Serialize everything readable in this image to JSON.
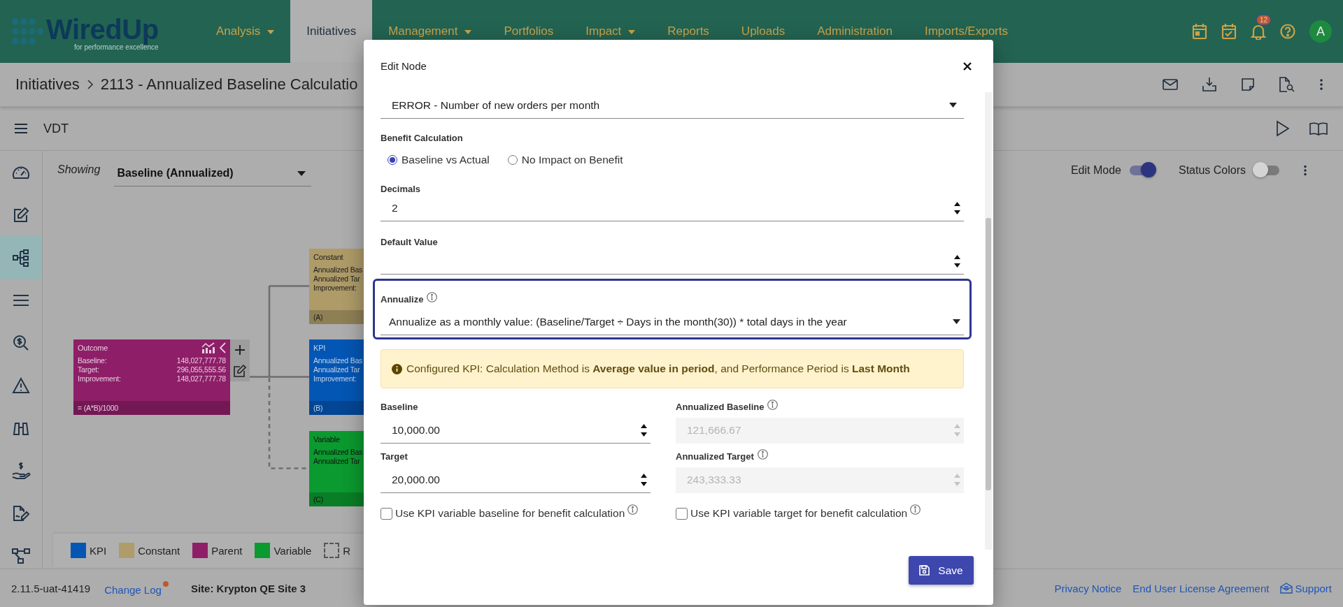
{
  "header": {
    "logo": {
      "name": "WiredUp",
      "tagline": "for performance excellence"
    },
    "nav": [
      {
        "label": "Analysis",
        "dropdown": true,
        "selected": false
      },
      {
        "label": "Initiatives",
        "dropdown": false,
        "selected": true
      },
      {
        "label": "Management",
        "dropdown": true,
        "selected": false
      },
      {
        "label": "Portfolios",
        "dropdown": false,
        "selected": false
      },
      {
        "label": "Impact",
        "dropdown": true,
        "selected": false
      },
      {
        "label": "Reports",
        "dropdown": false,
        "selected": false
      },
      {
        "label": "Uploads",
        "dropdown": false,
        "selected": false
      },
      {
        "label": "Administration",
        "dropdown": false,
        "selected": false
      },
      {
        "label": "Imports/Exports",
        "dropdown": false,
        "selected": false
      }
    ],
    "notification_count": "12",
    "avatar": "A"
  },
  "breadcrumb": [
    "Initiatives",
    "2113 - Annualized Baseline Calculatio"
  ],
  "toolbar": {
    "title": "VDT"
  },
  "sidebar": {
    "items": [
      {
        "kind": "gauge",
        "selected": false
      },
      {
        "kind": "edit",
        "selected": false
      },
      {
        "kind": "hierarchy",
        "selected": true
      },
      {
        "kind": "list",
        "selected": false
      },
      {
        "kind": "search",
        "selected": false
      },
      {
        "kind": "warning",
        "selected": false
      },
      {
        "kind": "binoculars",
        "selected": false
      },
      {
        "kind": "hand",
        "selected": false
      },
      {
        "kind": "document",
        "selected": false
      },
      {
        "kind": "network",
        "selected": false
      }
    ]
  },
  "view": {
    "showing_label": "Showing",
    "showing_value": "Baseline (Annualized)",
    "edit_mode": {
      "label": "Edit Mode",
      "on": true
    },
    "status_colors": {
      "label": "Status Colors",
      "on": false
    }
  },
  "nodes": [
    {
      "kind": "outcome",
      "title": "Outcome",
      "color": "#8e1e68",
      "rows": [
        {
          "label": "Baseline:",
          "value": "148,027,777.78"
        },
        {
          "label": "Target:",
          "value": "296,055,555.56"
        },
        {
          "label": "Improvement:",
          "value": "148,027,777.78"
        }
      ],
      "footer": "= (A*B)/1000"
    },
    {
      "kind": "constant",
      "title": "Constant",
      "color": "#ae9b68",
      "rows": [
        {
          "label": "Annualized Bas"
        },
        {
          "label": "Annualized Tar"
        },
        {
          "label": "Improvement:"
        }
      ],
      "footer": "(A)"
    },
    {
      "kind": "kpi",
      "title": "KPI",
      "color": "#0456b4",
      "rows": [
        {
          "label": "Annualized Bas"
        },
        {
          "label": "Annualized Tar"
        },
        {
          "label": "Improvement:"
        }
      ],
      "footer": "(B)"
    },
    {
      "kind": "variable",
      "title": "Variable",
      "color": "#0b9a2f",
      "rows": [
        {
          "label": "Annualized Bas"
        },
        {
          "label": "Annualized Tar"
        }
      ],
      "footer": "(C)"
    }
  ],
  "legend": [
    {
      "kind": "swatch",
      "label": "KPI",
      "color": "#0456b4"
    },
    {
      "kind": "swatch",
      "label": "Constant",
      "color": "#b09c6a"
    },
    {
      "kind": "swatch",
      "label": "Parent",
      "color": "#8e1e68"
    },
    {
      "kind": "swatch",
      "label": "Variable",
      "color": "#0b9a2f"
    },
    {
      "kind": "dashed",
      "label": "R"
    }
  ],
  "footer": {
    "version": "2.11.5-uat-41419",
    "change_log": "Change Log",
    "site": "Site: Krypton QE Site 3",
    "links": [
      {
        "label": "Privacy Notice",
        "kind": "link"
      },
      {
        "label": "End User License Agreement",
        "kind": "link"
      },
      {
        "label": "Support",
        "kind": "support"
      }
    ]
  },
  "dialog": {
    "title": "Edit Node",
    "kpi_select": "ERROR - Number of new orders per month",
    "benefit_calculation": {
      "label": "Benefit Calculation",
      "options": [
        {
          "label": "Baseline vs Actual",
          "selected": true
        },
        {
          "label": "No Impact on Benefit",
          "selected": false
        }
      ]
    },
    "decimals": {
      "label": "Decimals",
      "value": "2"
    },
    "default_value": {
      "label": "Default Value"
    },
    "annualize": {
      "label": "Annualize",
      "value": "Annualize as a monthly value: (Baseline/Target ÷ Days in the month(30)) * total days in the year",
      "focused": true
    },
    "alert": "Configured KPI: Calculation Method is **Average value in period**, and Performance Period is **Last Month**",
    "fields": [
      {
        "label": "Baseline",
        "value": "10,000.00",
        "disabled": false,
        "info": false
      },
      {
        "label": "Annualized Baseline",
        "value": "121,666.67",
        "disabled": true,
        "info": true
      },
      {
        "label": "Target",
        "value": "20,000.00",
        "disabled": false,
        "info": false
      },
      {
        "label": "Annualized Target",
        "value": "243,333.33",
        "disabled": true,
        "info": true
      }
    ],
    "checkboxes": [
      {
        "label": "Use KPI variable baseline for benefit calculation",
        "checked": false
      },
      {
        "label": "Use KPI variable target for benefit calculation",
        "checked": false
      }
    ],
    "save": "Save"
  }
}
